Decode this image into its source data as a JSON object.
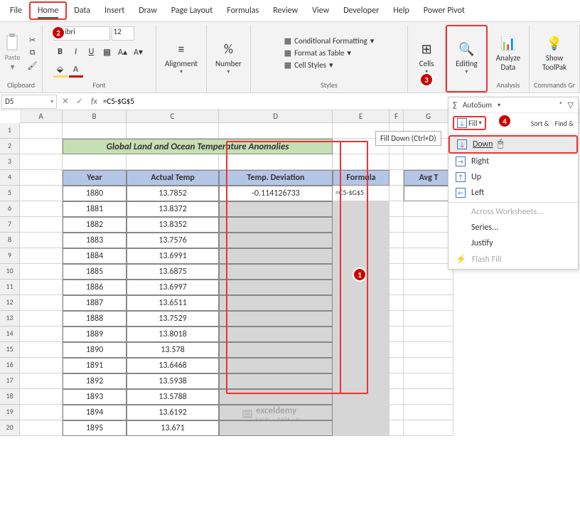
{
  "menu": {
    "file": "File",
    "home": "Home",
    "data_tab": "Data",
    "insert": "Insert",
    "draw": "Draw",
    "pagelayout": "Page Layout",
    "formulas": "Formulas",
    "review": "Review",
    "view": "View",
    "developer": "Developer",
    "help": "Help",
    "powerpivot": "Power Pivot"
  },
  "ribbon": {
    "clipboard": {
      "label": "Clipboard",
      "paste": "Paste"
    },
    "font": {
      "label": "Font",
      "name": "Calibri",
      "size": "12",
      "bold": "B",
      "italic": "I",
      "underline": "U"
    },
    "alignment": {
      "label": "Alignment"
    },
    "number": {
      "label": "Number"
    },
    "styles": {
      "label": "Styles",
      "conditional": "Conditional Formatting",
      "table": "Format as Table",
      "cell": "Cell Styles"
    },
    "cells": {
      "label": "Cells"
    },
    "editing": {
      "label": "Editing"
    },
    "analysis": {
      "label": "Analysis",
      "analyze": "Analyze",
      "data": "Data"
    },
    "commands": {
      "label": "Commands Gr",
      "show": "Show",
      "toolpak": "ToolPak"
    }
  },
  "namebox": "D5",
  "formula": "=C5-$G$5",
  "editing_panel": {
    "autosum": "AutoSum",
    "fill": "Fill",
    "sort": "Sort &",
    "find": "Find &"
  },
  "tooltip": "Fill Down (Ctrl+D)",
  "fillmenu": {
    "down": "Down",
    "right": "Right",
    "up": "Up",
    "left": "Left",
    "across": "Across Worksheets...",
    "series": "Series...",
    "justify": "Justify",
    "flash": "Flash Fill"
  },
  "cols": [
    "A",
    "B",
    "C",
    "D",
    "E",
    "F",
    "G"
  ],
  "title": "Global Land and Ocean Temperature Anomalies",
  "headers": {
    "year": "Year",
    "actual": "Actual Temp",
    "deviation": "Temp. Deviation",
    "formula": "Formula",
    "avg": "Avg T"
  },
  "data": [
    {
      "year": "1880",
      "actual": "13.7852",
      "dev": "-0.114126733",
      "formula": "=C5-$G$5"
    },
    {
      "year": "1881",
      "actual": "13.8372",
      "dev": "",
      "formula": ""
    },
    {
      "year": "1882",
      "actual": "13.8352",
      "dev": "",
      "formula": ""
    },
    {
      "year": "1883",
      "actual": "13.7576",
      "dev": "",
      "formula": ""
    },
    {
      "year": "1884",
      "actual": "13.6991",
      "dev": "",
      "formula": ""
    },
    {
      "year": "1885",
      "actual": "13.6875",
      "dev": "",
      "formula": ""
    },
    {
      "year": "1886",
      "actual": "13.6997",
      "dev": "",
      "formula": ""
    },
    {
      "year": "1887",
      "actual": "13.6511",
      "dev": "",
      "formula": ""
    },
    {
      "year": "1888",
      "actual": "13.7529",
      "dev": "",
      "formula": ""
    },
    {
      "year": "1889",
      "actual": "13.8018",
      "dev": "",
      "formula": ""
    },
    {
      "year": "1890",
      "actual": "13.578",
      "dev": "",
      "formula": ""
    },
    {
      "year": "1891",
      "actual": "13.6468",
      "dev": "",
      "formula": ""
    },
    {
      "year": "1892",
      "actual": "13.5938",
      "dev": "",
      "formula": ""
    },
    {
      "year": "1893",
      "actual": "13.5788",
      "dev": "",
      "formula": ""
    },
    {
      "year": "1894",
      "actual": "13.6192",
      "dev": "",
      "formula": ""
    },
    {
      "year": "1895",
      "actual": "13.671",
      "dev": "",
      "formula": ""
    }
  ],
  "watermark": "exceldemy",
  "watermark_sub": "EXCEL · DATA · BI"
}
